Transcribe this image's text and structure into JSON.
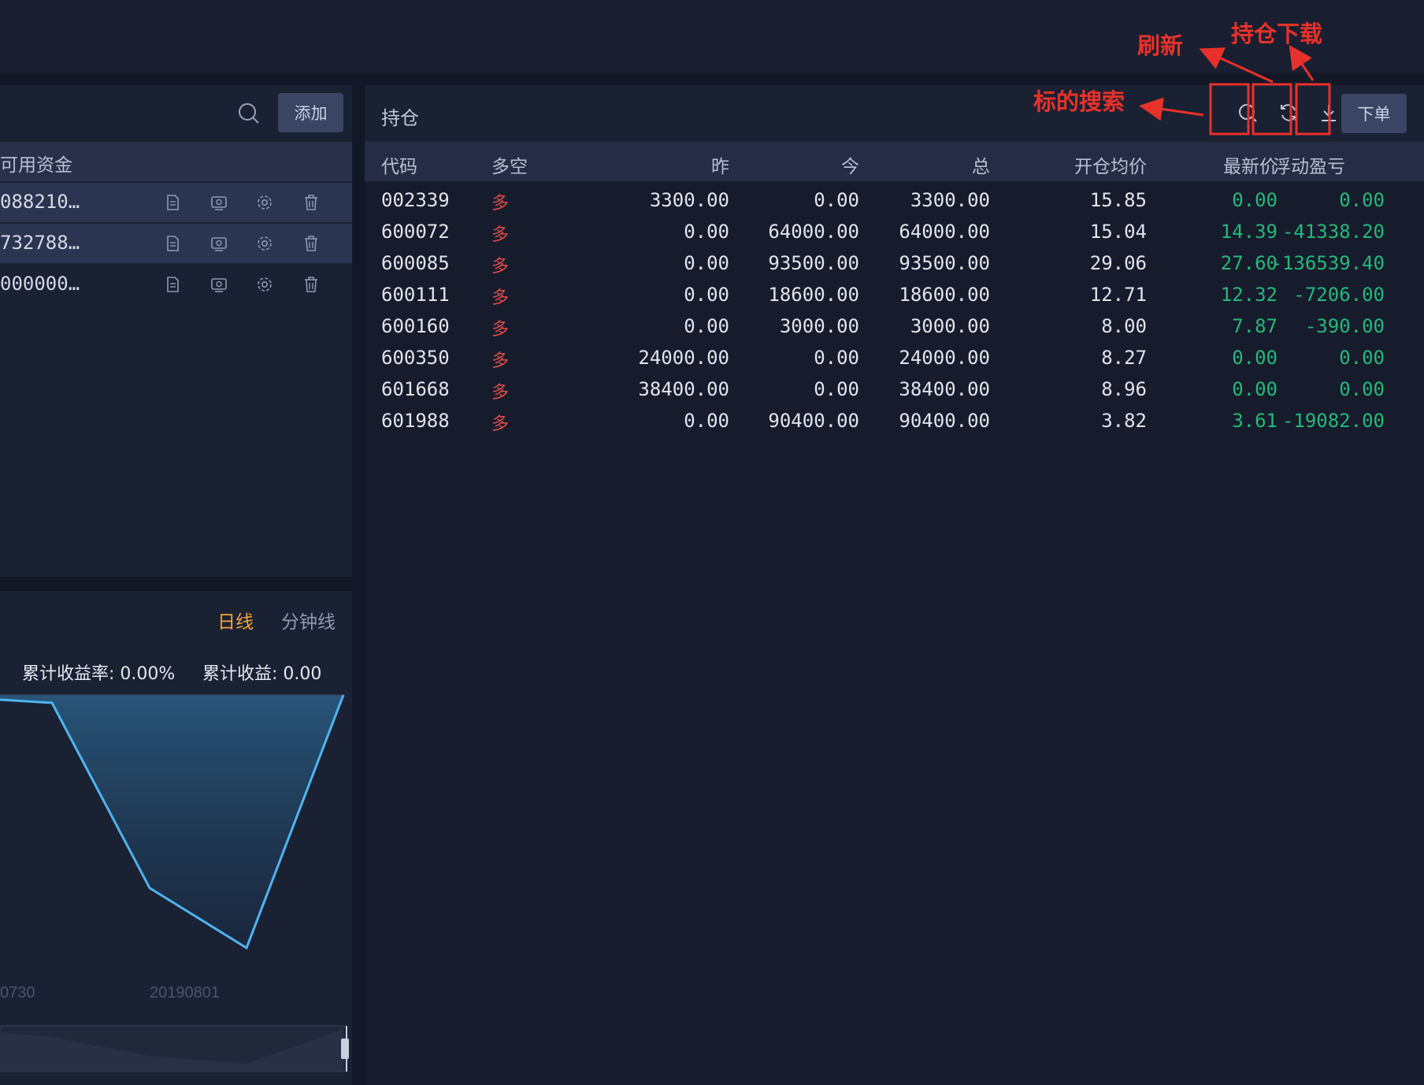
{
  "left_top": {
    "add_button": "添加",
    "column_header": "可用资金",
    "accounts": [
      {
        "id": "088210…"
      },
      {
        "id": "732788…"
      },
      {
        "id": "000000…"
      }
    ],
    "row_icons": [
      "document-icon",
      "wallet-icon",
      "gear-icon",
      "trash-icon"
    ]
  },
  "left_bottom": {
    "tab_day": "日线",
    "tab_minute": "分钟线",
    "cum_rate_label": "累计收益率: 0.00%",
    "cum_return_label": "累计收益: 0.00",
    "x_tick_1": "0730",
    "x_tick_2": "20190801"
  },
  "positions": {
    "title": "持仓",
    "order_button": "下单",
    "columns": [
      "代码",
      "多空",
      "昨",
      "今",
      "总",
      "开仓均价",
      "最新价",
      "浮动盈亏"
    ],
    "rows": [
      {
        "code": "002339",
        "side": "多",
        "yesterday": "3300.00",
        "today": "0.00",
        "total": "3300.00",
        "avg_price": "15.85",
        "last_price": "0.00",
        "pnl": "0.00"
      },
      {
        "code": "600072",
        "side": "多",
        "yesterday": "0.00",
        "today": "64000.00",
        "total": "64000.00",
        "avg_price": "15.04",
        "last_price": "14.39",
        "pnl": "-41338.20"
      },
      {
        "code": "600085",
        "side": "多",
        "yesterday": "0.00",
        "today": "93500.00",
        "total": "93500.00",
        "avg_price": "29.06",
        "last_price": "27.60",
        "pnl": "-136539.40"
      },
      {
        "code": "600111",
        "side": "多",
        "yesterday": "0.00",
        "today": "18600.00",
        "total": "18600.00",
        "avg_price": "12.71",
        "last_price": "12.32",
        "pnl": "-7206.00"
      },
      {
        "code": "600160",
        "side": "多",
        "yesterday": "0.00",
        "today": "3000.00",
        "total": "3000.00",
        "avg_price": "8.00",
        "last_price": "7.87",
        "pnl": "-390.00"
      },
      {
        "code": "600350",
        "side": "多",
        "yesterday": "24000.00",
        "today": "0.00",
        "total": "24000.00",
        "avg_price": "8.27",
        "last_price": "0.00",
        "pnl": "0.00"
      },
      {
        "code": "601668",
        "side": "多",
        "yesterday": "38400.00",
        "today": "0.00",
        "total": "38400.00",
        "avg_price": "8.96",
        "last_price": "0.00",
        "pnl": "0.00"
      },
      {
        "code": "601988",
        "side": "多",
        "yesterday": "0.00",
        "today": "90400.00",
        "total": "90400.00",
        "avg_price": "3.82",
        "last_price": "3.61",
        "pnl": "-19082.00"
      }
    ]
  },
  "annotations": {
    "search": "标的搜索",
    "refresh": "刷新",
    "download": "持仓下载"
  },
  "colors": {
    "accent_tab": "#f2a63a",
    "long_side": "#e04b4b",
    "price_green": "#25b87a",
    "annotation_red": "#e8312a",
    "chart_line": "#4fb4f0"
  }
}
